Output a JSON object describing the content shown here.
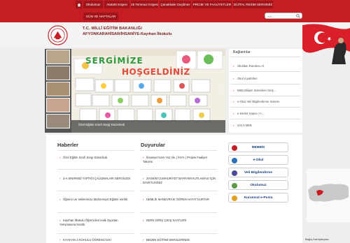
{
  "nav": {
    "items": [
      "Okulumuz",
      "Atatürk Köşesi",
      "15 Temmuz Köşesi",
      "Çanakkale Geçilmez",
      "PROJE VE FAALİYETLER",
      "DİJİTAL RESİM SERGİMİZ",
      "GÜN VE HAFTALAR"
    ],
    "search_placeholder": "Ara..."
  },
  "header": {
    "line1": "T.C. MİLLÎ EĞİTİM BAKANLIĞI",
    "line2": "AFYONKARAHİSAR/İHSANİYE-Kayıhan İlkokulu"
  },
  "slider": {
    "caption": "Özel Eğitim Sınıfı Sergi Düzenledi",
    "banner1": "SERGİMİZE",
    "banner2": "HOŞGELDİNİZ"
  },
  "links": {
    "title": "Bağlantılar",
    "items": [
      "Okuldan Randevu Al",
      "Okul Kıyafetleri",
      "MEB Bilişim Sistemleri Giriş...",
      "e-Okul Veli Bilgilendirme Sistemi",
      "e-Devlet Kapısı >>...",
      "444 0 MEB"
    ]
  },
  "news": {
    "title": "Haberler",
    "items": [
      "Özel Eğitim Sınıfı Sergi Düzenledi",
      "3-A SINIFIMIZ YAPTIĞI ÇALIŞMALARI SERGİLEDİ",
      "Öğrenci ve Velilerimize Mahremiyet Eğitimi Verildi",
      "Kayıhan İlkokulu Öğrencileri Halk Oyunları Yarışmasına Katıldı",
      "KAYIHAN 3 KOHULU ÖĞRENCİ EKİ"
    ]
  },
  "announcements": {
    "title": "Duyurular",
    "items": [
      "İhsaniye'mizin Yüz Akı ( İHYA ) Projesi Faaliyet Takvimi",
      "29 EKİM CUMHURİYET BAYRAMI KUTLAMASI İÇİN DAVETLİSİNİZ",
      "HEMLİK MANEVRASI ÖĞREN HAYAT KURTAR",
      "DERS GİRİŞ ÇIKIŞ SAATLERİ",
      "BEDEN EĞİTİMİ DERSLERİNDE"
    ]
  },
  "services": [
    "MEBBİS",
    "e-Okul",
    "Veli Bilgilendirme",
    "Okulumuz",
    "Kurumsal e-Posta"
  ],
  "donate": "Bağış Kampanyası",
  "colors": {
    "brand_red": "#c51d24",
    "nav_btn": "#a0141a",
    "service_text": "#1a3d7c"
  }
}
